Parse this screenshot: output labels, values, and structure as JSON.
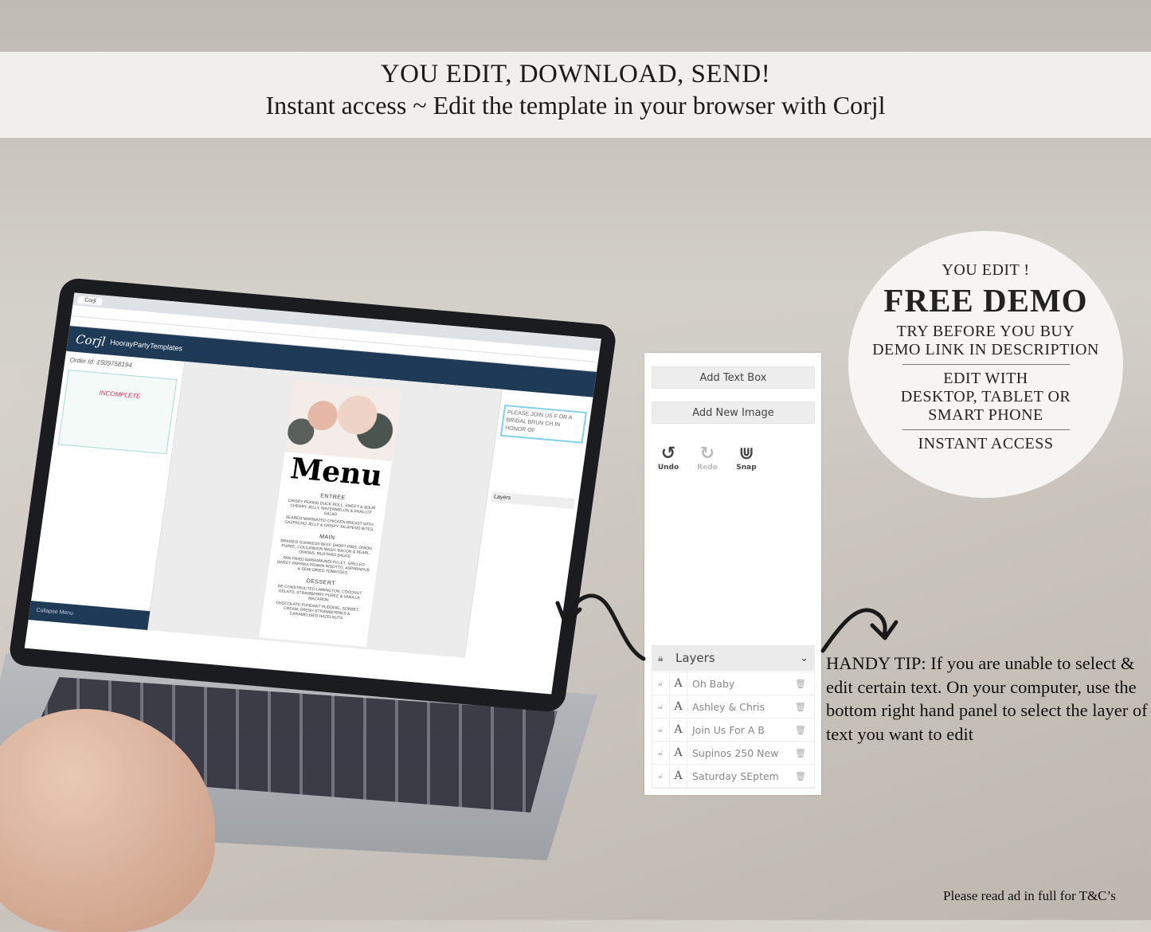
{
  "banner": {
    "line1": "YOU EDIT, DOWNLOAD, SEND!",
    "line2": "Instant access ~ Edit the template in your browser with Corjl"
  },
  "badge": {
    "line1": "YOU EDIT !",
    "title": "FREE DEMO",
    "line2": "TRY BEFORE YOU BUY",
    "line3": "DEMO LINK IN DESCRIPTION",
    "line4": "EDIT WITH",
    "line5": "DESKTOP, TABLET OR",
    "line6": "SMART PHONE",
    "line7": "INSTANT ACCESS"
  },
  "laptop": {
    "tab": "Corjl",
    "app_logo": "Corjl",
    "app_name": "HoorayPartyTemplates",
    "order_id": "Order Id: 1509758194",
    "status": "INCOMPLETE",
    "collapse": "Collapse Menu",
    "menu": {
      "title": "Menu",
      "sections": [
        {
          "name": "ENTREE",
          "items": [
            "CRISPY PEKING DUCK ROLL, SWEET & SOUR CHERRY JELLY, WATERMELON & SHALLOT SALAD",
            "SEARED MARINATED CHICKEN BREAST WITH GAZPACHO JELLY & CRISPY JALAPENO BITES"
          ]
        },
        {
          "name": "MAIN",
          "items": [
            "BRAISED GUINNESS BEEF SHORT RIBS, ONION PUREE, COLCANNON MASH, BACON & PEARL ONIONS, MUSTARD SAUCE",
            "PAN FRIED BARRAMUNDI FILLET, GRILLED SWEET PAPRIKA PRAWN RISOTTO, ASPARAGUS & SEMI DRIED TOMATOES"
          ]
        },
        {
          "name": "DESSERT",
          "items": [
            "DE-CONSTRUCTED LAMINGTON, COCONUT GELATO, STRAWBERRY PUREE & VANILLA MACARON",
            "CHOCOLATE FONDANT PUDDING, SORBET, CREAM, FRESH STRAWBERRIES & CARAMELISED HAZELNUTS"
          ]
        }
      ]
    },
    "textbox": "PLEASE JOIN US F OR A BRIDAL BRUN CH IN HONOR OF",
    "layers": "Layers"
  },
  "panel": {
    "add_text": "Add Text Box",
    "add_image": "Add New Image",
    "tools": [
      {
        "label": "Undo",
        "icon": "undo-icon"
      },
      {
        "label": "Redo",
        "icon": "redo-icon"
      },
      {
        "label": "Snap",
        "icon": "magnet-icon"
      }
    ],
    "layers_title": "Layers",
    "layers": [
      "Oh Baby",
      "Ashley & Chris",
      "Join Us For A B",
      "Supinos 250 New",
      "Saturday SEptem"
    ]
  },
  "tip": "HANDY TIP: If you are unable to select & edit certain text. On your computer, use the bottom right hand panel to select the layer of text you want to edit",
  "footer": "Please read ad in full for T&C’s"
}
